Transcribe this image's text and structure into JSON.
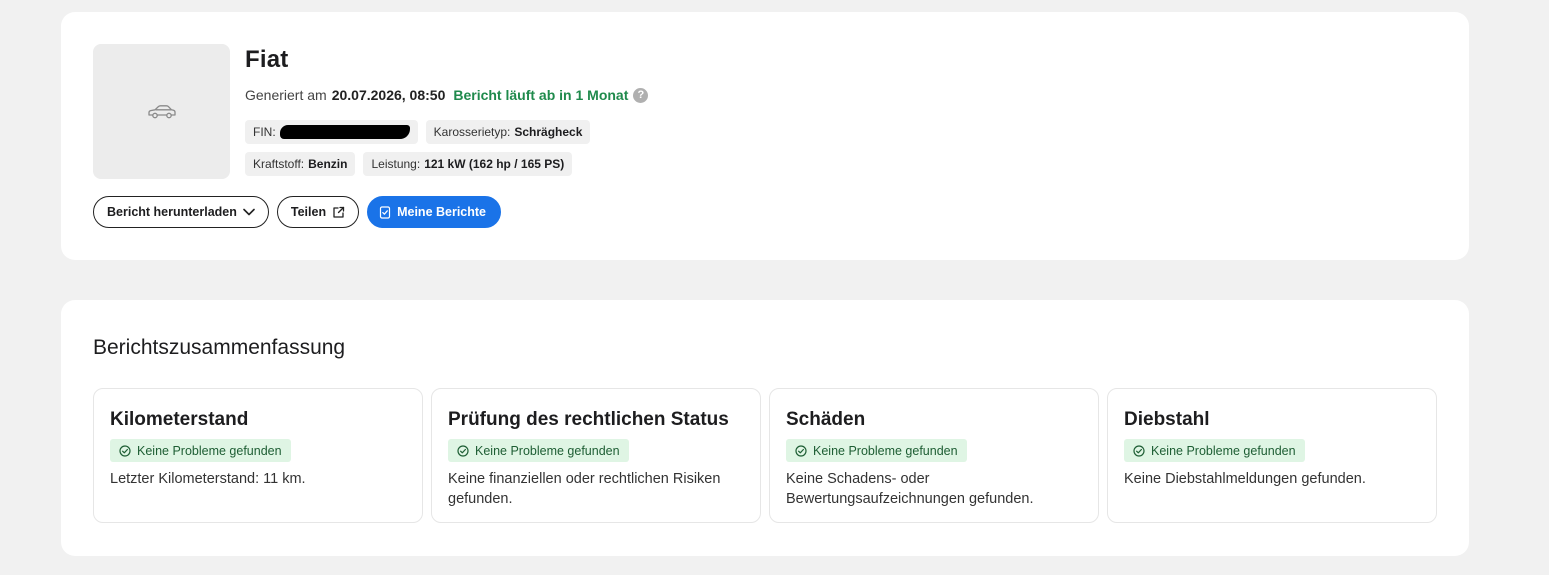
{
  "vehicle": {
    "title": "Fiat",
    "generated_label": "Generiert am",
    "generated_date": "20.07.2026, 08:50",
    "expiry": "Bericht läuft ab in 1 Monat",
    "help_glyph": "?",
    "thumbnail_icon": "car-icon",
    "chips": {
      "fin_label": "FIN:",
      "body_label": "Karosserietyp:",
      "body_value": "Schrägheck",
      "fuel_label": "Kraftstoff:",
      "fuel_value": "Benzin",
      "power_label": "Leistung:",
      "power_value": "121 kW (162 hp / 165 PS)"
    }
  },
  "actions": {
    "download_label": "Bericht herunterladen",
    "share_label": "Teilen",
    "my_reports_label": "Meine Berichte"
  },
  "summary": {
    "title": "Berichtszusammenfassung",
    "tiles": [
      {
        "title": "Kilometerstand",
        "badge": "Keine Probleme gefunden",
        "description": "Letzter Kilometerstand: 11 km."
      },
      {
        "title": "Prüfung des rechtlichen Status",
        "badge": "Keine Probleme gefunden",
        "description": "Keine finanziellen oder rechtlichen Risiken gefunden."
      },
      {
        "title": "Schäden",
        "badge": "Keine Probleme gefunden",
        "description": "Keine Schadens- oder Bewertungsaufzeichnungen gefunden."
      },
      {
        "title": "Diebstahl",
        "badge": "Keine Probleme gefunden",
        "description": "Keine Diebstahlmeldungen gefunden."
      }
    ]
  },
  "colors": {
    "primary": "#1a73e8",
    "success_text": "#1f8a4c",
    "badge_bg": "#dff5e4",
    "page_bg": "#f1f1f1"
  }
}
